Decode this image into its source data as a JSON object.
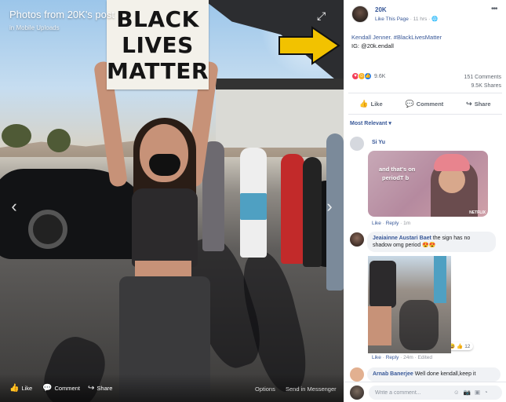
{
  "viewer": {
    "title": "Photos from 20K's post",
    "subtitle": "in Mobile Uploads",
    "sign_lines": [
      "BLACK",
      "LIVES",
      "MATTER"
    ],
    "footer": {
      "like": "Like",
      "comment": "Comment",
      "share": "Share",
      "options": "Options",
      "send": "Send in Messenger"
    }
  },
  "post": {
    "page_name": "20K",
    "like_page": "Like This Page",
    "time": "11 hrs",
    "caption_line1": "Kendall Jenner. #BlackLivesMatter",
    "caption_line2": "IG: @20k.endall",
    "reaction_count": "9.6K",
    "comments_count": "151 Comments",
    "shares_count": "9.5K Shares",
    "actions": {
      "like": "Like",
      "comment": "Comment",
      "share": "Share"
    },
    "sort_label": "Most Relevant"
  },
  "comments": [
    {
      "name": "Si Yu",
      "gif_text_line1": "and that's on",
      "gif_text_line2": "periodT b",
      "gif_mark": "NETFLIX",
      "like": "Like",
      "reply": "Reply",
      "time": "1m"
    },
    {
      "name": "Jeaiainne Austari Baet",
      "text": "the sign has no shadow omg period 😍😍",
      "like": "Like",
      "reply": "Reply",
      "time": "24m",
      "edited": "Edited",
      "reaction_count": "12"
    },
    {
      "name": "Arnab Banerjee",
      "text": "Well done kendall,keep it"
    }
  ],
  "comment_box": {
    "placeholder": "Write a comment..."
  },
  "colors": {
    "link": "#385898",
    "annotation_arrow": "#f2c200",
    "meta": "#90949c"
  }
}
